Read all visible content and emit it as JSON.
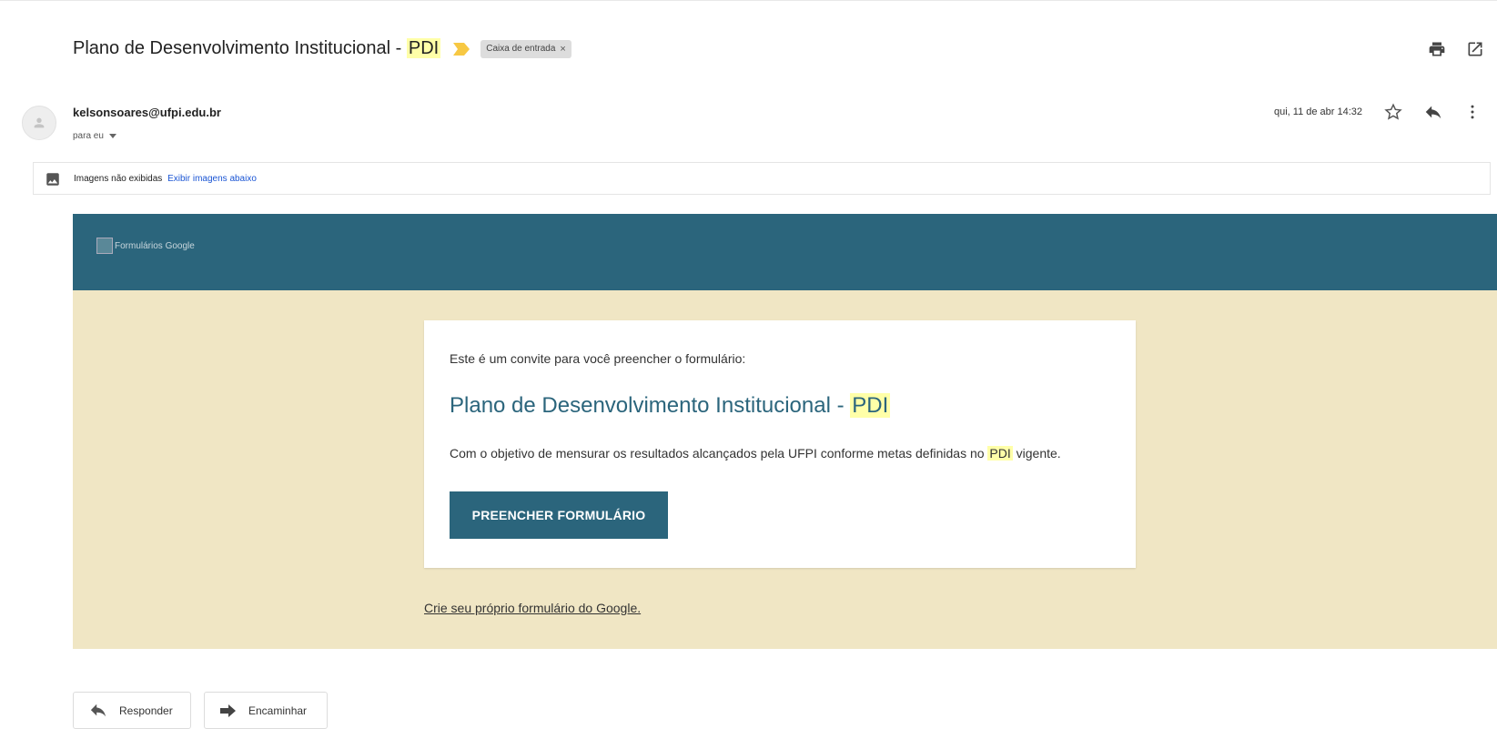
{
  "subject": {
    "title_prefix": "Plano de Desenvolvimento Institucional - ",
    "title_highlight": "PDI",
    "label": "Caixa de entrada",
    "label_remove": "×"
  },
  "sender": {
    "email": "kelsonsoares@ufpi.edu.br",
    "to": "para eu",
    "date": "qui, 11 de abr 14:32"
  },
  "images_notice": {
    "text": "Imagens não exibidas",
    "link": "Exibir imagens abaixo"
  },
  "form_email": {
    "logo_alt": "Formulários Google",
    "invite_text": "Este é um convite para você preencher o formulário:",
    "title_prefix": "Plano de Desenvolvimento Institucional - ",
    "title_highlight": "PDI",
    "description_prefix": "Com o objetivo de mensurar os resultados alcançados pela UFPI conforme metas definidas no ",
    "description_highlight": "PDI",
    "description_suffix": " vigente.",
    "button_label": "PREENCHER FORMULÁRIO",
    "create_link": "Crie seu próprio formulário do Google."
  },
  "actions": {
    "reply": "Responder",
    "forward": "Encaminhar"
  },
  "colors": {
    "brand_teal": "#2b657c",
    "content_bg": "#f0e6c4",
    "highlight": "#ffffa8",
    "important_marker": "#f7c843",
    "link_blue": "#1a55d4"
  },
  "icons": [
    "important-marker-icon",
    "print-icon",
    "open-new-window-icon",
    "avatar-icon",
    "star-icon",
    "reply-icon",
    "more-vert-icon",
    "image-icon",
    "forward-icon"
  ]
}
